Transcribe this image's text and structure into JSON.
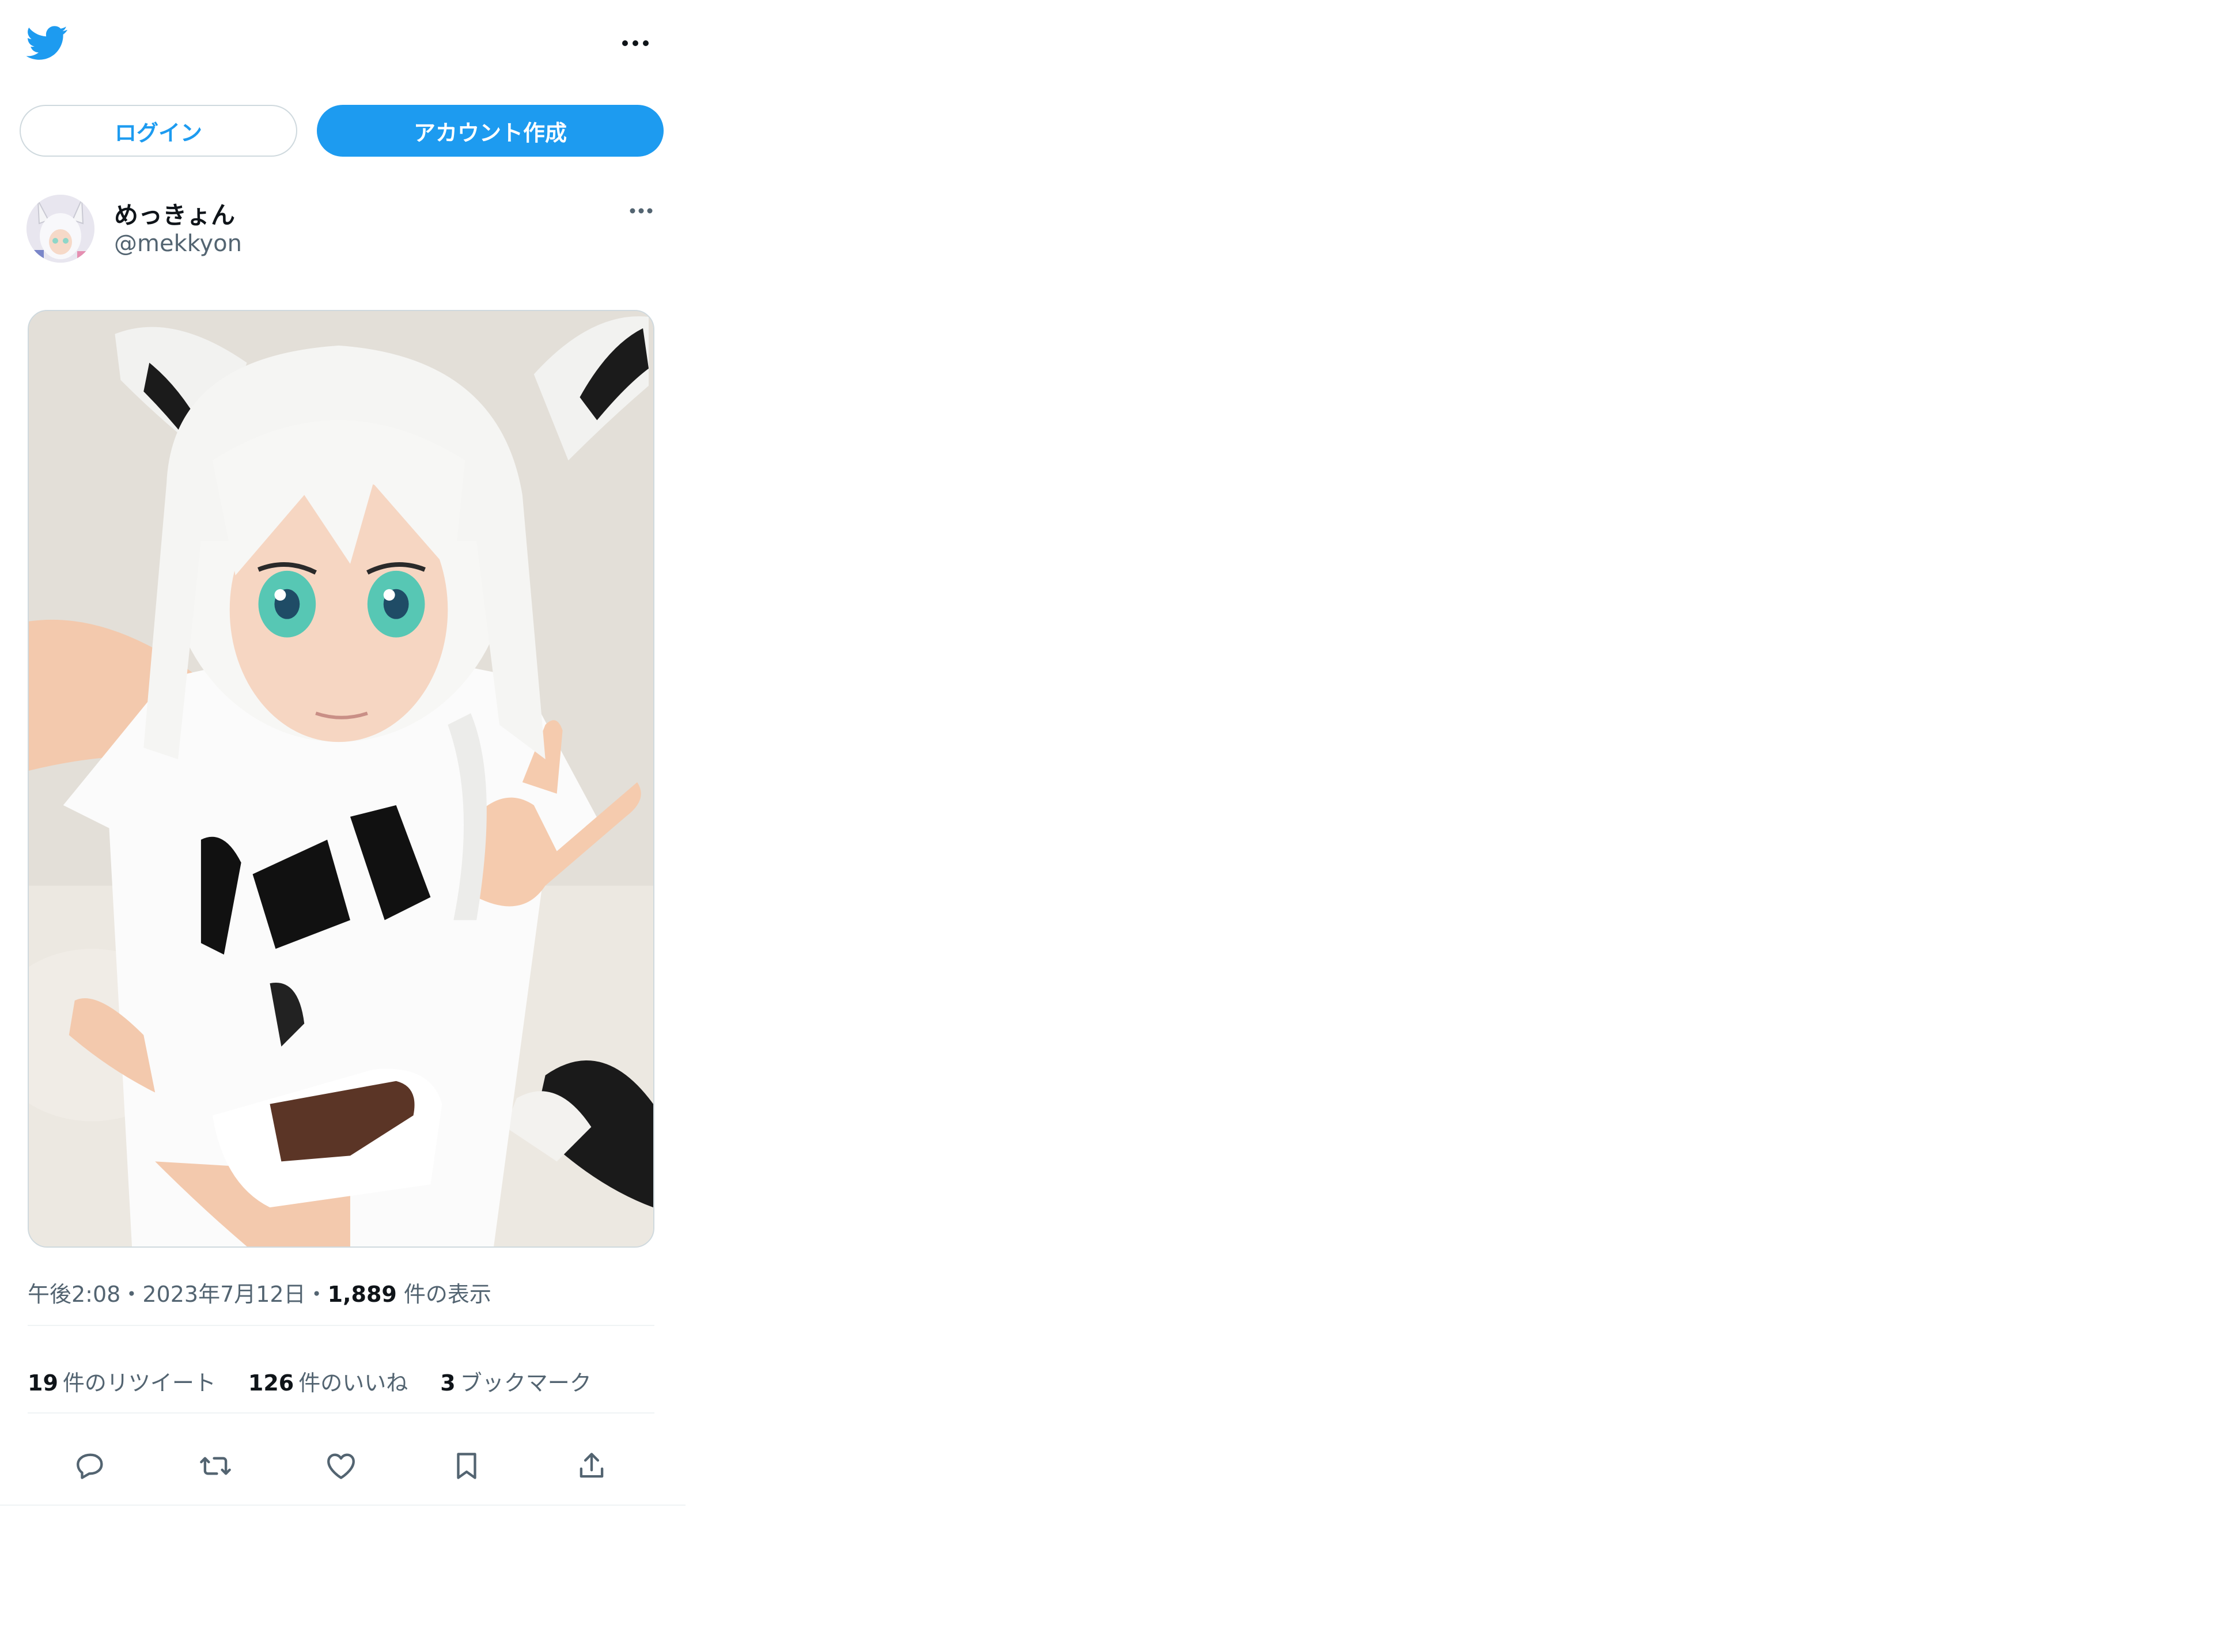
{
  "colors": {
    "brand": "#1d9bf0",
    "text_primary": "#0f1419",
    "text_secondary": "#536471",
    "border": "#cfd9de"
  },
  "header": {
    "logo_icon": "twitter-bird-icon",
    "more_icon": "more-horizontal-icon"
  },
  "auth": {
    "login_label": "ログイン",
    "signup_label": "アカウント作成"
  },
  "tweet": {
    "author": {
      "display_name": "めっきょん",
      "handle": "@mekkyon"
    },
    "media_icon": "photo",
    "time": "午後2:08",
    "dot": "・",
    "date": "2023年7月12日",
    "sep": "・",
    "views_count": "1,889",
    "views_label": "件の表示",
    "stats": {
      "retweets_count": "19",
      "retweets_label": "件のリツイート",
      "likes_count": "126",
      "likes_label": "件のいいね",
      "bookmarks_count": "3",
      "bookmarks_label": "ブックマーク"
    },
    "actions": [
      "reply-icon",
      "retweet-icon",
      "like-icon",
      "bookmark-icon",
      "share-icon"
    ]
  }
}
